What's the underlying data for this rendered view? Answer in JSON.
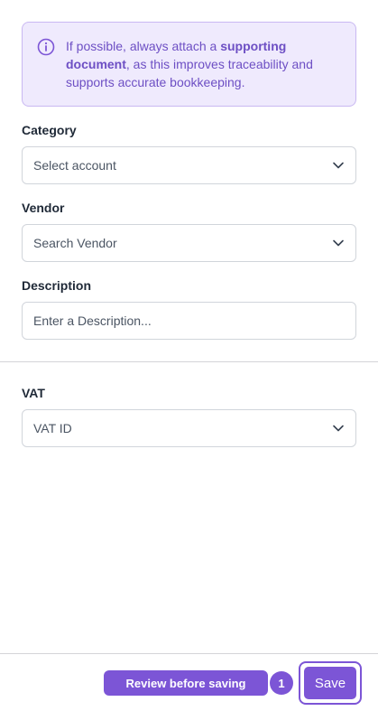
{
  "notice": {
    "text_before": "If possible, always attach a ",
    "text_bold": "supporting document",
    "text_after": ", as this improves traceability and supports accurate bookkeeping.",
    "icon": "info-icon"
  },
  "fields": {
    "category": {
      "label": "Category",
      "value": "Select account"
    },
    "vendor": {
      "label": "Vendor",
      "value": "Search Vendor"
    },
    "description": {
      "label": "Description",
      "placeholder": "Enter a Description..."
    },
    "vat": {
      "label": "VAT",
      "value": "VAT ID"
    }
  },
  "footer": {
    "review_label": "Review before saving",
    "review_count": "1",
    "save_label": "Save"
  },
  "colors": {
    "accent": "#7c55d6",
    "notice_bg": "#efeafd",
    "notice_text": "#6d4fc4"
  }
}
